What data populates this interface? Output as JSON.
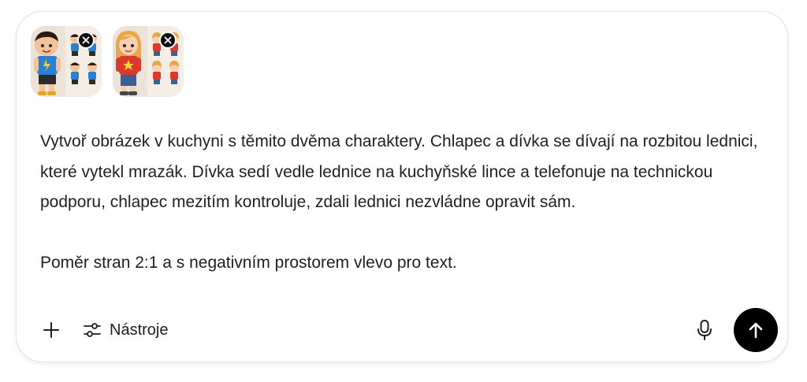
{
  "attachments": [
    {
      "name": "boy-character-sheet",
      "remove_icon": "close-icon"
    },
    {
      "name": "girl-character-sheet",
      "remove_icon": "close-icon"
    }
  ],
  "prompt": {
    "text": "Vytvoř obrázek v kuchyni s těmito dvěma charaktery. Chlapec a dívka se dívají na rozbitou lednici, které vytekl mrazák. Dívka sedí vedle lednice na kuchyňské lince a telefonuje na technickou podporu, chlapec mezitím kontroluje, zdali lednici nezvládne opravit sám.\n\nPoměr stran 2:1 a s negativním prostorem vlevo pro text."
  },
  "toolbar": {
    "add_icon": "plus-icon",
    "tools_icon": "sliders-icon",
    "tools_label": "Nástroje",
    "mic_icon": "microphone-icon",
    "send_icon": "arrow-up-icon"
  },
  "colors": {
    "send_background": "#000000",
    "text": "#1f1f1f",
    "border": "#e3e3e3"
  }
}
